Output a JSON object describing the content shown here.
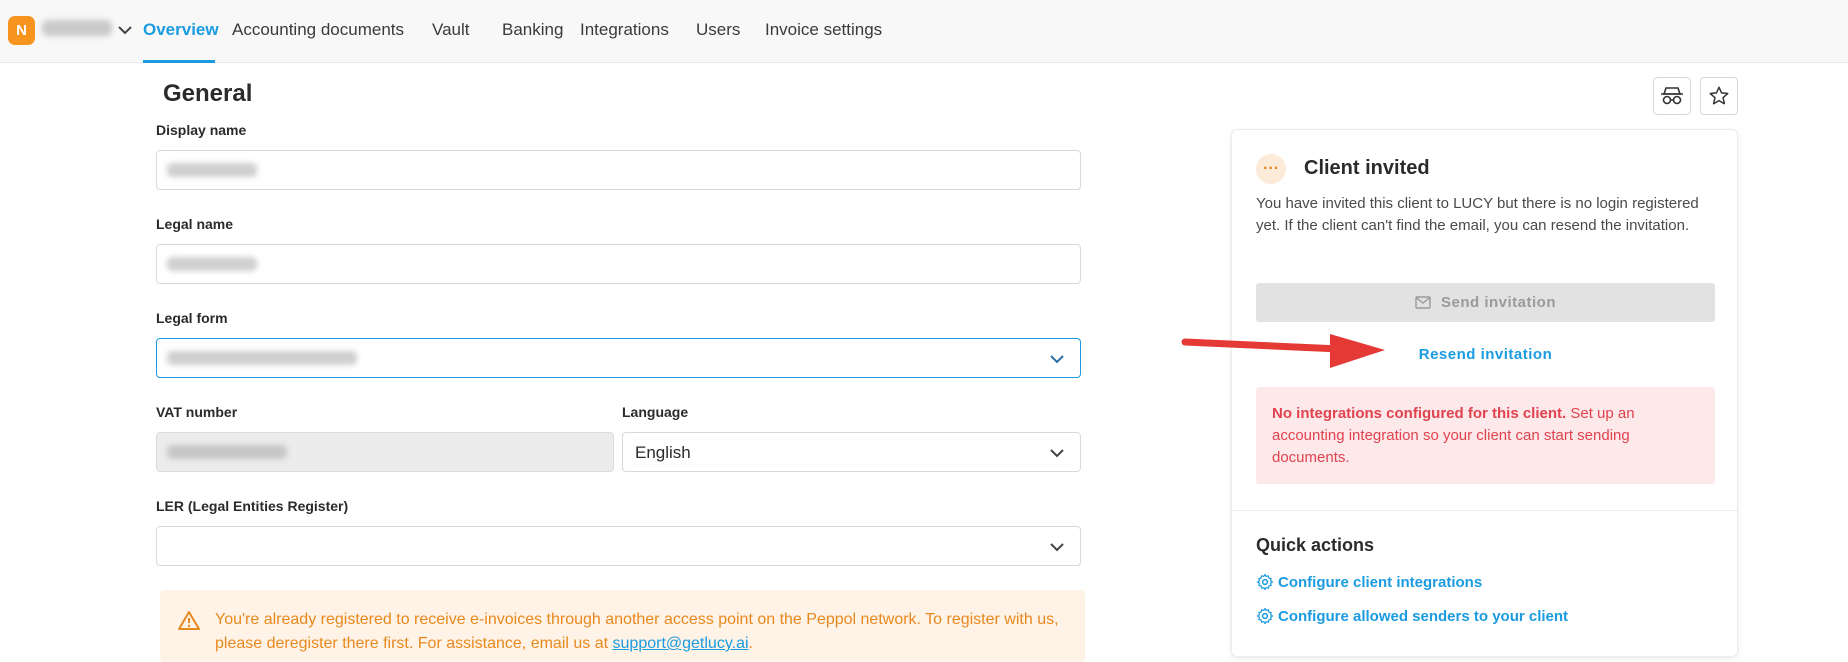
{
  "nav": {
    "avatar_initial": "N",
    "tabs": [
      "Overview",
      "Accounting documents",
      "Vault",
      "Banking",
      "Integrations",
      "Users",
      "Invoice settings"
    ]
  },
  "form": {
    "title": "General",
    "display_name_label": "Display name",
    "legal_name_label": "Legal name",
    "legal_form_label": "Legal form",
    "vat_label": "VAT number",
    "language_label": "Language",
    "language_value": "English",
    "ler_label": "LER (Legal Entities Register)",
    "warning_text": "You're already registered to receive e-invoices through another access point on the Peppol network. To register with us, please deregister there first. For assistance, email us at ",
    "warning_link": "support@getlucy.ai",
    "warning_end": "."
  },
  "card": {
    "status_symbol": "···",
    "title": "Client invited",
    "description": "You have invited this client to LUCY but there is no login registered yet. If the client can't find the email, you can resend the invitation.",
    "send_button": "Send invitation",
    "resend_link": "Resend invitation",
    "alert_bold": "No integrations configured for this client.",
    "alert_text": " Set up an accounting integration so your client can start sending documents.",
    "quick_actions_title": "Quick actions",
    "quick_actions": [
      "Configure client integrations",
      "Configure allowed senders to your client"
    ]
  },
  "colors": {
    "accent": "#1b9be0",
    "brand_orange": "#f7941d",
    "alert_red": "#e0434f",
    "warning_orange": "#e8891f",
    "annotation_arrow": "#e53935"
  },
  "icons": {
    "avatar": "company-avatar",
    "company_menu": "chevron-down-icon",
    "incognito": "incognito-icon",
    "favorite": "star-icon",
    "dropdowns": "chevron-down-icon",
    "warning": "warning-triangle-icon",
    "send": "envelope-icon",
    "quick_actions": "gear-icon",
    "annotation": "red-arrow-annotation"
  }
}
